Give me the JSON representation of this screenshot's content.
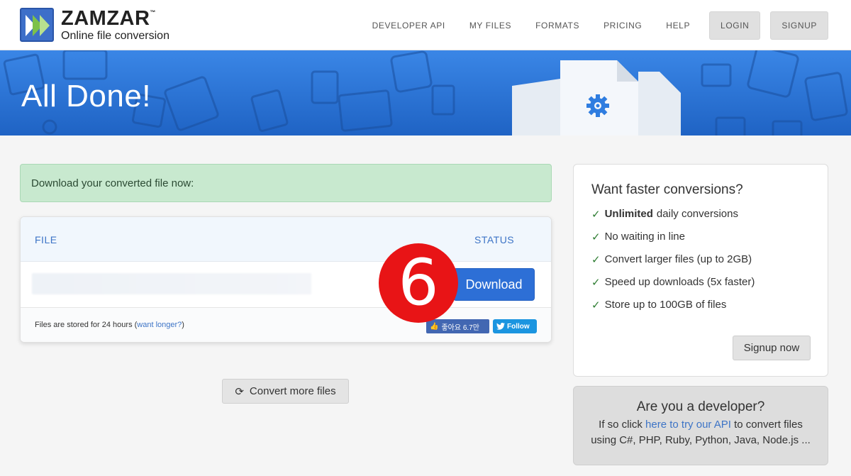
{
  "header": {
    "brand": "ZAMZAR",
    "trademark": "™",
    "tagline": "Online file conversion",
    "nav": [
      "DEVELOPER API",
      "MY FILES",
      "FORMATS",
      "PRICING",
      "HELP"
    ],
    "login_label": "LOGIN",
    "signup_label": "SIGNUP"
  },
  "banner": {
    "title": "All Done!"
  },
  "alert": {
    "text": "Download your converted file now:"
  },
  "file_table": {
    "col_file": "FILE",
    "col_status": "STATUS",
    "download_label": "Download",
    "storage_note_prefix": "Files are stored for 24 hours (",
    "storage_link": "want longer?",
    "storage_note_suffix": ")",
    "fb_like": "좋아요 6.7만",
    "tw_follow": "Follow"
  },
  "step_badge": "6",
  "convert_more_label": "Convert more files",
  "promo": {
    "title": "Want faster conversions?",
    "items": [
      {
        "bold": "Unlimited",
        "text": "daily conversions"
      },
      {
        "bold": "",
        "text": "No waiting in line"
      },
      {
        "bold": "",
        "text": "Convert larger files (up to 2GB)"
      },
      {
        "bold": "",
        "text": "Speed up downloads (5x faster)"
      },
      {
        "bold": "",
        "text": "Store up to 100GB of files"
      }
    ],
    "signup_label": "Signup now"
  },
  "developer": {
    "title": "Are you a developer?",
    "text_prefix": "If so click ",
    "link": "here to try our API",
    "text_suffix": " to convert files using C#, PHP, Ruby, Python, Java, Node.js ..."
  },
  "colors": {
    "brand_blue": "#2d6fd6",
    "alert_green": "#c8e9cf",
    "badge_red": "#e81416"
  }
}
